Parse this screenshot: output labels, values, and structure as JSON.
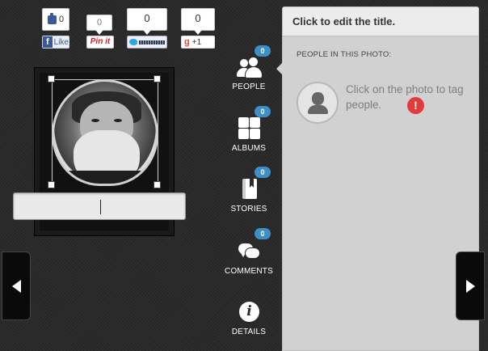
{
  "share": {
    "facebook": {
      "count": "0",
      "label": "Like"
    },
    "pinterest": {
      "count": "0",
      "label": "Pin it"
    },
    "twitter": {
      "count": "0"
    },
    "google_plus": {
      "count": "0",
      "label": "+1"
    }
  },
  "nav": {
    "people": {
      "label": "PEOPLE",
      "count": "0",
      "icon": "people-icon"
    },
    "albums": {
      "label": "ALBUMS",
      "count": "0",
      "icon": "albums-icon"
    },
    "stories": {
      "label": "STORIES",
      "count": "0",
      "icon": "stories-icon"
    },
    "comments": {
      "label": "COMMENTS",
      "count": "0",
      "icon": "comments-icon"
    },
    "details": {
      "label": "DETAILS",
      "icon": "info-icon"
    }
  },
  "panel": {
    "title": "Click to edit the title.",
    "section_label": "PEOPLE IN THIS PHOTO:",
    "tag_prompt": "Click on the photo to tag people.",
    "alert_symbol": "!"
  },
  "colors": {
    "badge": "#3d8fc6",
    "alert": "#e23b3b",
    "panel_bg": "#d1d1d1"
  }
}
